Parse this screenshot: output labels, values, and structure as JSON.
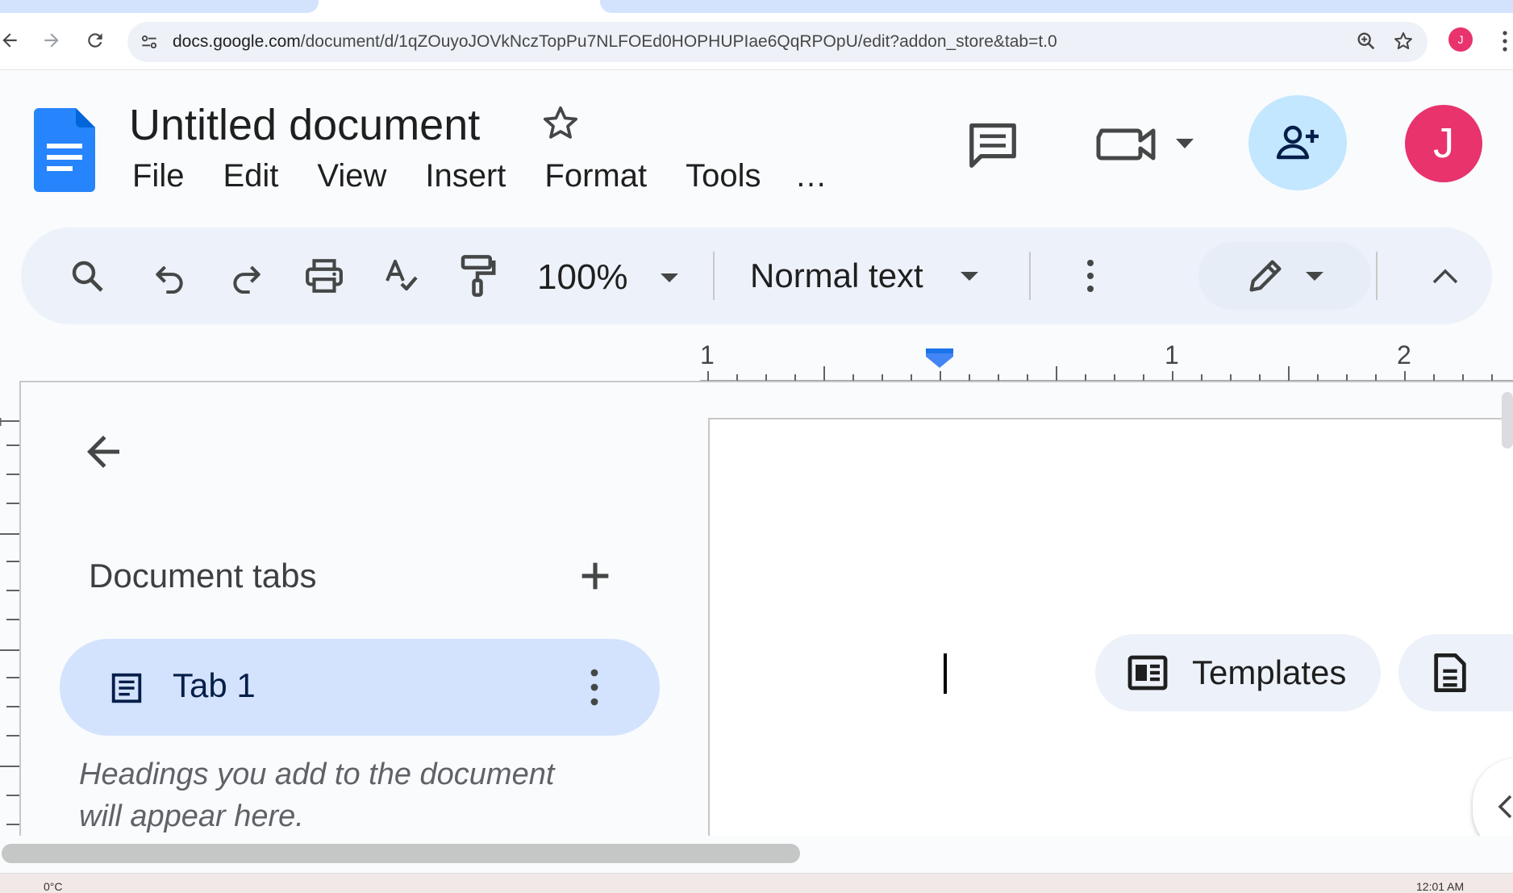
{
  "browser": {
    "url_host": "docs.google.com",
    "url_path": "/document/d/1qZOuyoJOVkNczTopPu7NLFOEd0HOPHUPIae6QqRPOpU/edit?addon_store&tab=t.0",
    "profile_initial": "J"
  },
  "header": {
    "title": "Untitled document",
    "menus": [
      "File",
      "Edit",
      "View",
      "Insert",
      "Format",
      "Tools"
    ],
    "more_menus": "…",
    "avatar_initial": "J"
  },
  "toolbar": {
    "zoom": "100%",
    "paragraph_style": "Normal text"
  },
  "ruler": {
    "labels": [
      "1",
      "1",
      "2"
    ]
  },
  "outline": {
    "title": "Document tabs",
    "tabs": [
      {
        "label": "Tab 1"
      }
    ],
    "hint": "Headings you add to the document will appear here."
  },
  "page": {
    "chips": {
      "templates": "Templates"
    }
  },
  "taskbar": {
    "temp": "0°C",
    "clock": "12:01 AM"
  },
  "colors": {
    "accent": "#1a73e8",
    "tab_selected": "#d3e3fd",
    "share_bg": "#c2e7ff",
    "avatar": "#e8336d"
  }
}
